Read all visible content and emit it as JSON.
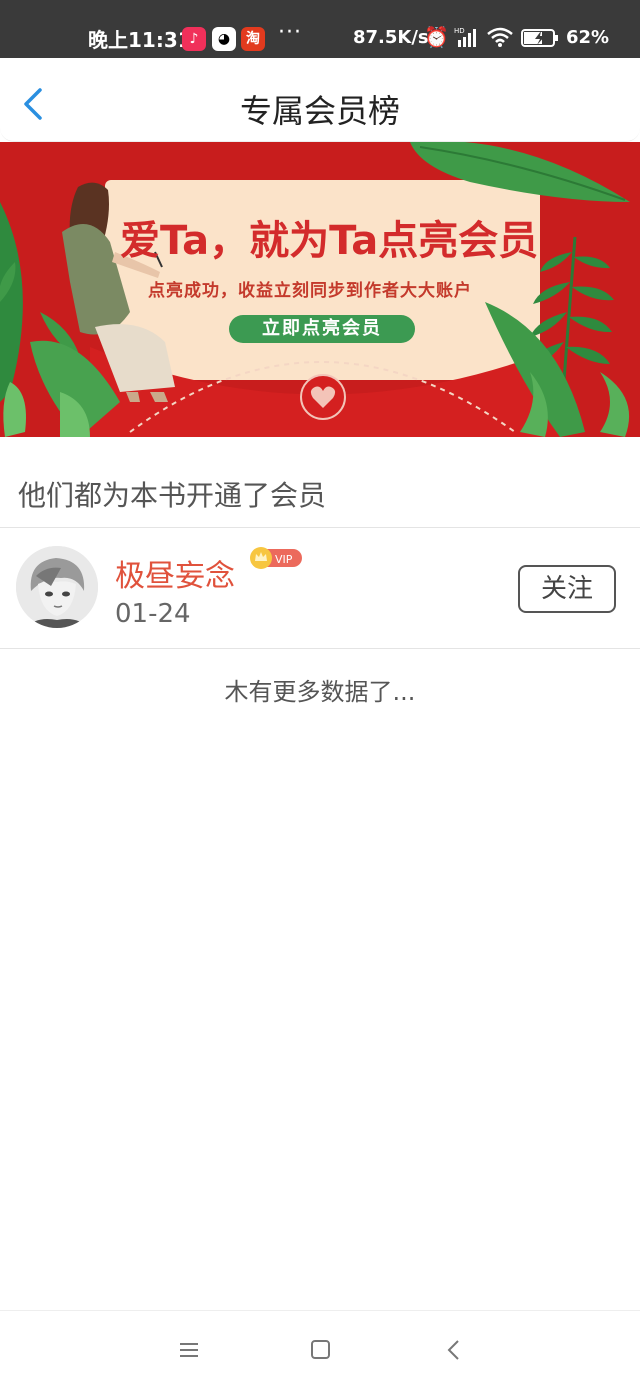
{
  "status_bar": {
    "time": "晚上11:31",
    "apps": [
      {
        "name": "douyin-icon",
        "glyph": "♪",
        "color": "#f0305a"
      },
      {
        "name": "qq-icon",
        "glyph": "🐧",
        "color": "#ffffff"
      },
      {
        "name": "taobao-icon",
        "glyph": "淘",
        "color": "#e23a1e"
      }
    ],
    "more": "···",
    "net_speed": "87.5K/s",
    "battery": "62%"
  },
  "nav": {
    "back_icon": "chevron-left-icon",
    "title": "专属会员榜"
  },
  "banner": {
    "headline": "爱Ta，就为Ta点亮会员",
    "subtitle": "点亮成功，收益立刻同步到作者大大账户",
    "cta": "立即点亮会员",
    "colors": {
      "background": "#c81d1d",
      "card": "#fbe3c9",
      "leaf": "#3f9a48"
    }
  },
  "section": {
    "title": "他们都为本书开通了会员"
  },
  "members": [
    {
      "name": "极昼妄念",
      "badge": "VIP",
      "date": "01-24",
      "follow_label": "关注"
    }
  ],
  "footer": {
    "no_more": "木有更多数据了..."
  },
  "accent": "#2a8fe0"
}
